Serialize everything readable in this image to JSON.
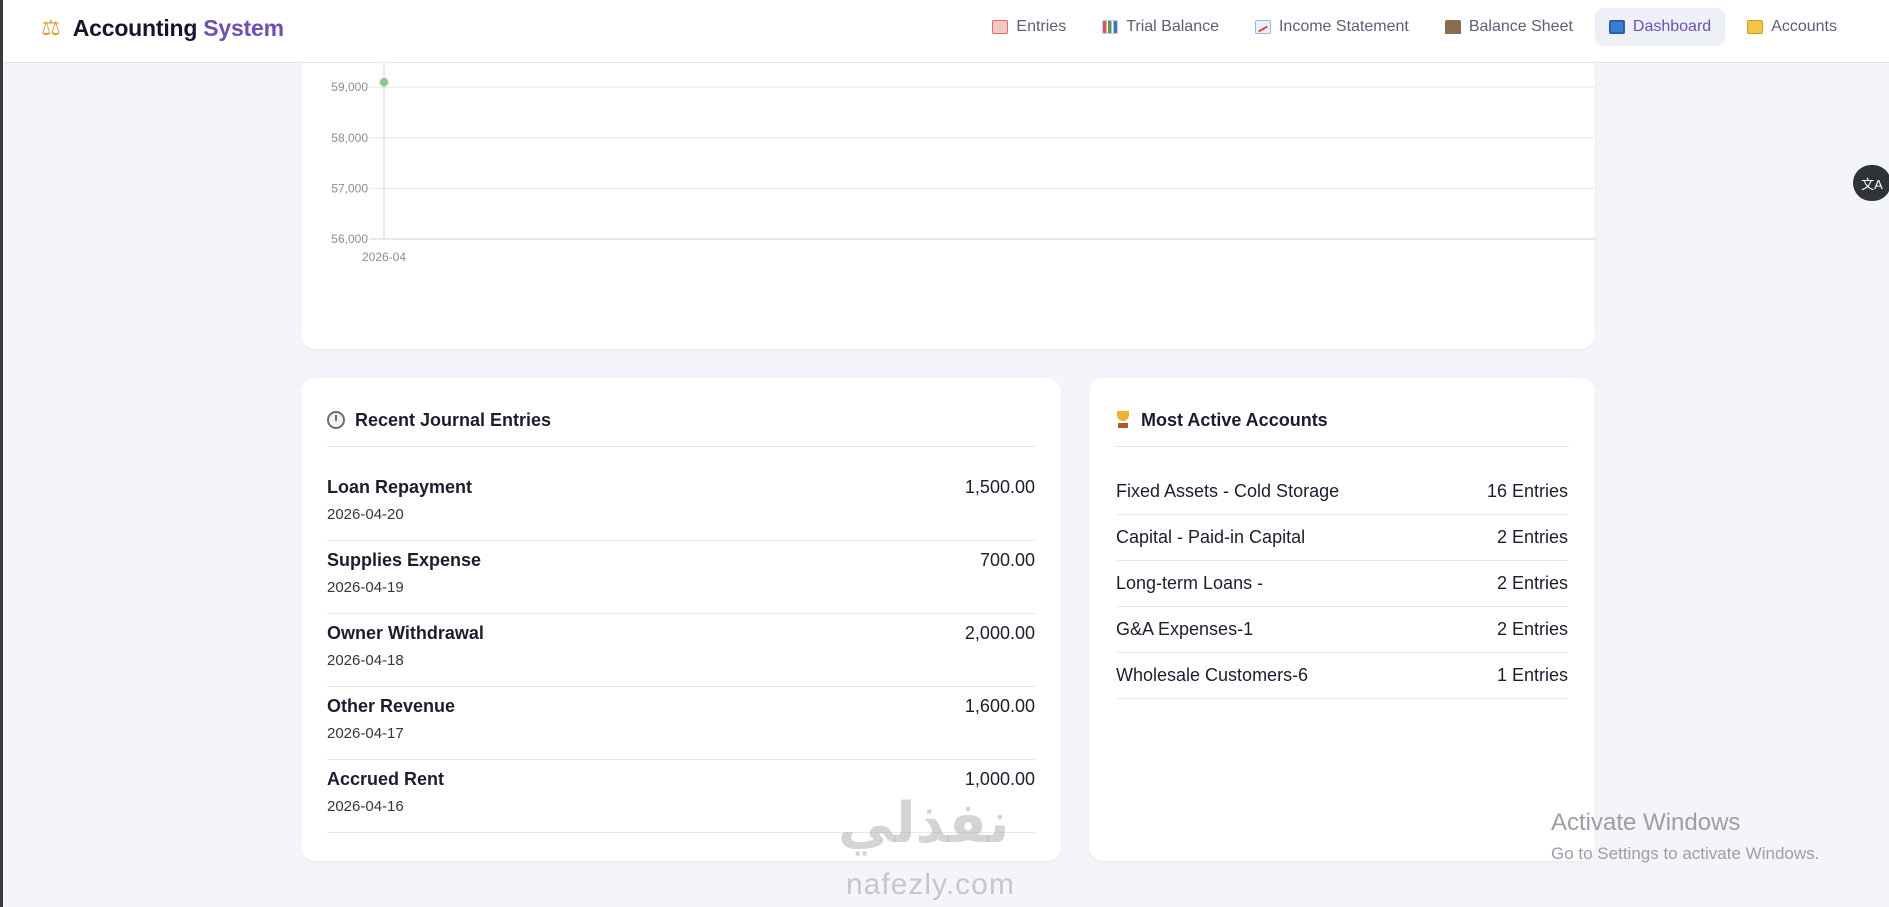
{
  "app": {
    "brand_main": "Accounting",
    "brand_accent": "System",
    "brand_icon": "scales-icon"
  },
  "nav": [
    {
      "label": "Entries",
      "icon": "memo-icon",
      "active": false
    },
    {
      "label": "Trial Balance",
      "icon": "bar-chart-icon",
      "active": false
    },
    {
      "label": "Income Statement",
      "icon": "trending-up-icon",
      "active": false
    },
    {
      "label": "Balance Sheet",
      "icon": "bank-icon",
      "active": false
    },
    {
      "label": "Dashboard",
      "icon": "monitor-icon",
      "active": true
    },
    {
      "label": "Accounts",
      "icon": "folder-icon",
      "active": false
    }
  ],
  "colors": {
    "accent": "#6e4fb3",
    "point": "#8cc48f",
    "grid": "#e8e9ee"
  },
  "chart_data": {
    "type": "line",
    "x": [
      "2026-04"
    ],
    "series": [
      {
        "values": [
          59100
        ]
      }
    ],
    "y_ticks": [
      56000,
      57000,
      58000,
      59000
    ],
    "y_tick_labels": [
      "56,000",
      "57,000",
      "58,000",
      "59,000"
    ],
    "x_tick_labels": [
      "2026-04"
    ],
    "ylim": [
      56000,
      59600
    ],
    "grid": true
  },
  "recent": {
    "title": "Recent Journal Entries",
    "entries": [
      {
        "name": "Loan Repayment",
        "date": "2026-04-20",
        "amount": "1,500.00"
      },
      {
        "name": "Supplies Expense",
        "date": "2026-04-19",
        "amount": "700.00"
      },
      {
        "name": "Owner Withdrawal",
        "date": "2026-04-18",
        "amount": "2,000.00"
      },
      {
        "name": "Other Revenue",
        "date": "2026-04-17",
        "amount": "1,600.00"
      },
      {
        "name": "Accrued Rent",
        "date": "2026-04-16",
        "amount": "1,000.00"
      }
    ]
  },
  "active": {
    "title": "Most Active Accounts",
    "accounts": [
      {
        "name": "Fixed Assets - Cold Storage",
        "count": "16 Entries"
      },
      {
        "name": "Capital - Paid-in Capital",
        "count": "2 Entries"
      },
      {
        "name": "Long-term Loans -",
        "count": "2 Entries"
      },
      {
        "name": "G&A Expenses-1",
        "count": "2 Entries"
      },
      {
        "name": "Wholesale Customers-6",
        "count": "1 Entries"
      }
    ]
  },
  "watermark": {
    "activate_title": "Activate Windows",
    "activate_sub": "Go to Settings to activate Windows.",
    "logo_text": "نفذلي",
    "url": "nafezly.com"
  }
}
